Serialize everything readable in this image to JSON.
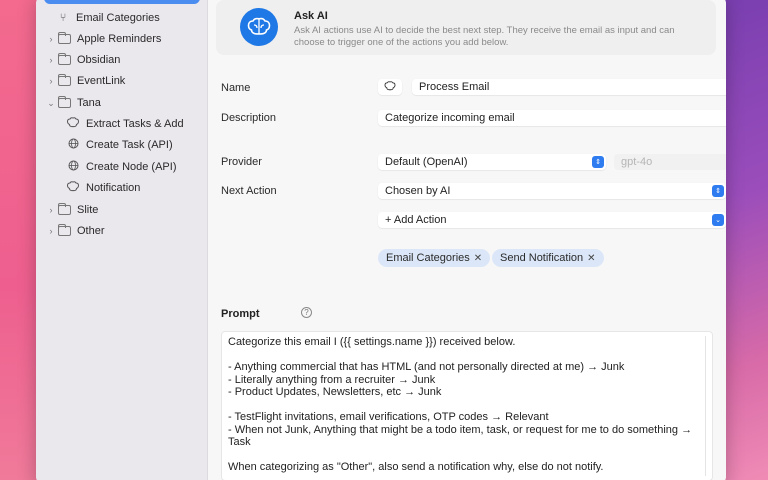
{
  "sidebar": {
    "items": [
      {
        "label": "Email Categories",
        "icon": "split-icon",
        "type": "action"
      },
      {
        "label": "Apple Reminders",
        "icon": "folder-icon",
        "type": "folder"
      },
      {
        "label": "Obsidian",
        "icon": "folder-icon",
        "type": "folder"
      },
      {
        "label": "EventLink",
        "icon": "folder-icon",
        "type": "folder"
      },
      {
        "label": "Tana",
        "icon": "folder-icon",
        "type": "folder",
        "expanded": true
      },
      {
        "label": "Extract Tasks & Add",
        "icon": "brain-icon",
        "type": "action"
      },
      {
        "label": "Create Task (API)",
        "icon": "globe-icon",
        "type": "action"
      },
      {
        "label": "Create Node (API)",
        "icon": "globe-icon",
        "type": "action"
      },
      {
        "label": "Notification",
        "icon": "brain-icon",
        "type": "action"
      },
      {
        "label": "Slite",
        "icon": "folder-icon",
        "type": "folder"
      },
      {
        "label": "Other",
        "icon": "folder-icon",
        "type": "folder"
      }
    ]
  },
  "header": {
    "title": "Ask AI",
    "description": "Ask AI actions use AI to decide the best next step. They receive the email as input and can choose to trigger one of the actions you add below.",
    "accent": "#1e78e6"
  },
  "form": {
    "name_label": "Name",
    "name_value": "Process Email",
    "description_label": "Description",
    "description_value": "Categorize incoming email",
    "provider_label": "Provider",
    "provider_value": "Default (OpenAI)",
    "model_placeholder": "gpt-4o",
    "next_action_label": "Next Action",
    "next_action_value": "Chosen by AI",
    "add_action_label": "+ Add Action",
    "chips": [
      {
        "label": "Email Categories"
      },
      {
        "label": "Send Notification"
      }
    ],
    "help_glyph": "?"
  },
  "prompt": {
    "title": "Prompt",
    "lines": [
      "Categorize this email I ({{ settings.name }}) received below.",
      "",
      "- Anything commercial that has HTML (and not personally directed at me) → Junk",
      "- Literally anything from a recruiter → Junk",
      "- Product Updates, Newsletters, etc → Junk",
      "",
      "- TestFlight invitations, email verifications, OTP codes → Relevant",
      "- When not Junk, Anything that might be a todo item, task, or request for me to do something →",
      "Task",
      "",
      "When categorizing as \"Other\", also send a notification why, else do not notify."
    ]
  },
  "colors": {
    "selection": "#4a8cf0",
    "chip_bg": "#dbe7f8",
    "select_button": "#2f7cf0"
  }
}
